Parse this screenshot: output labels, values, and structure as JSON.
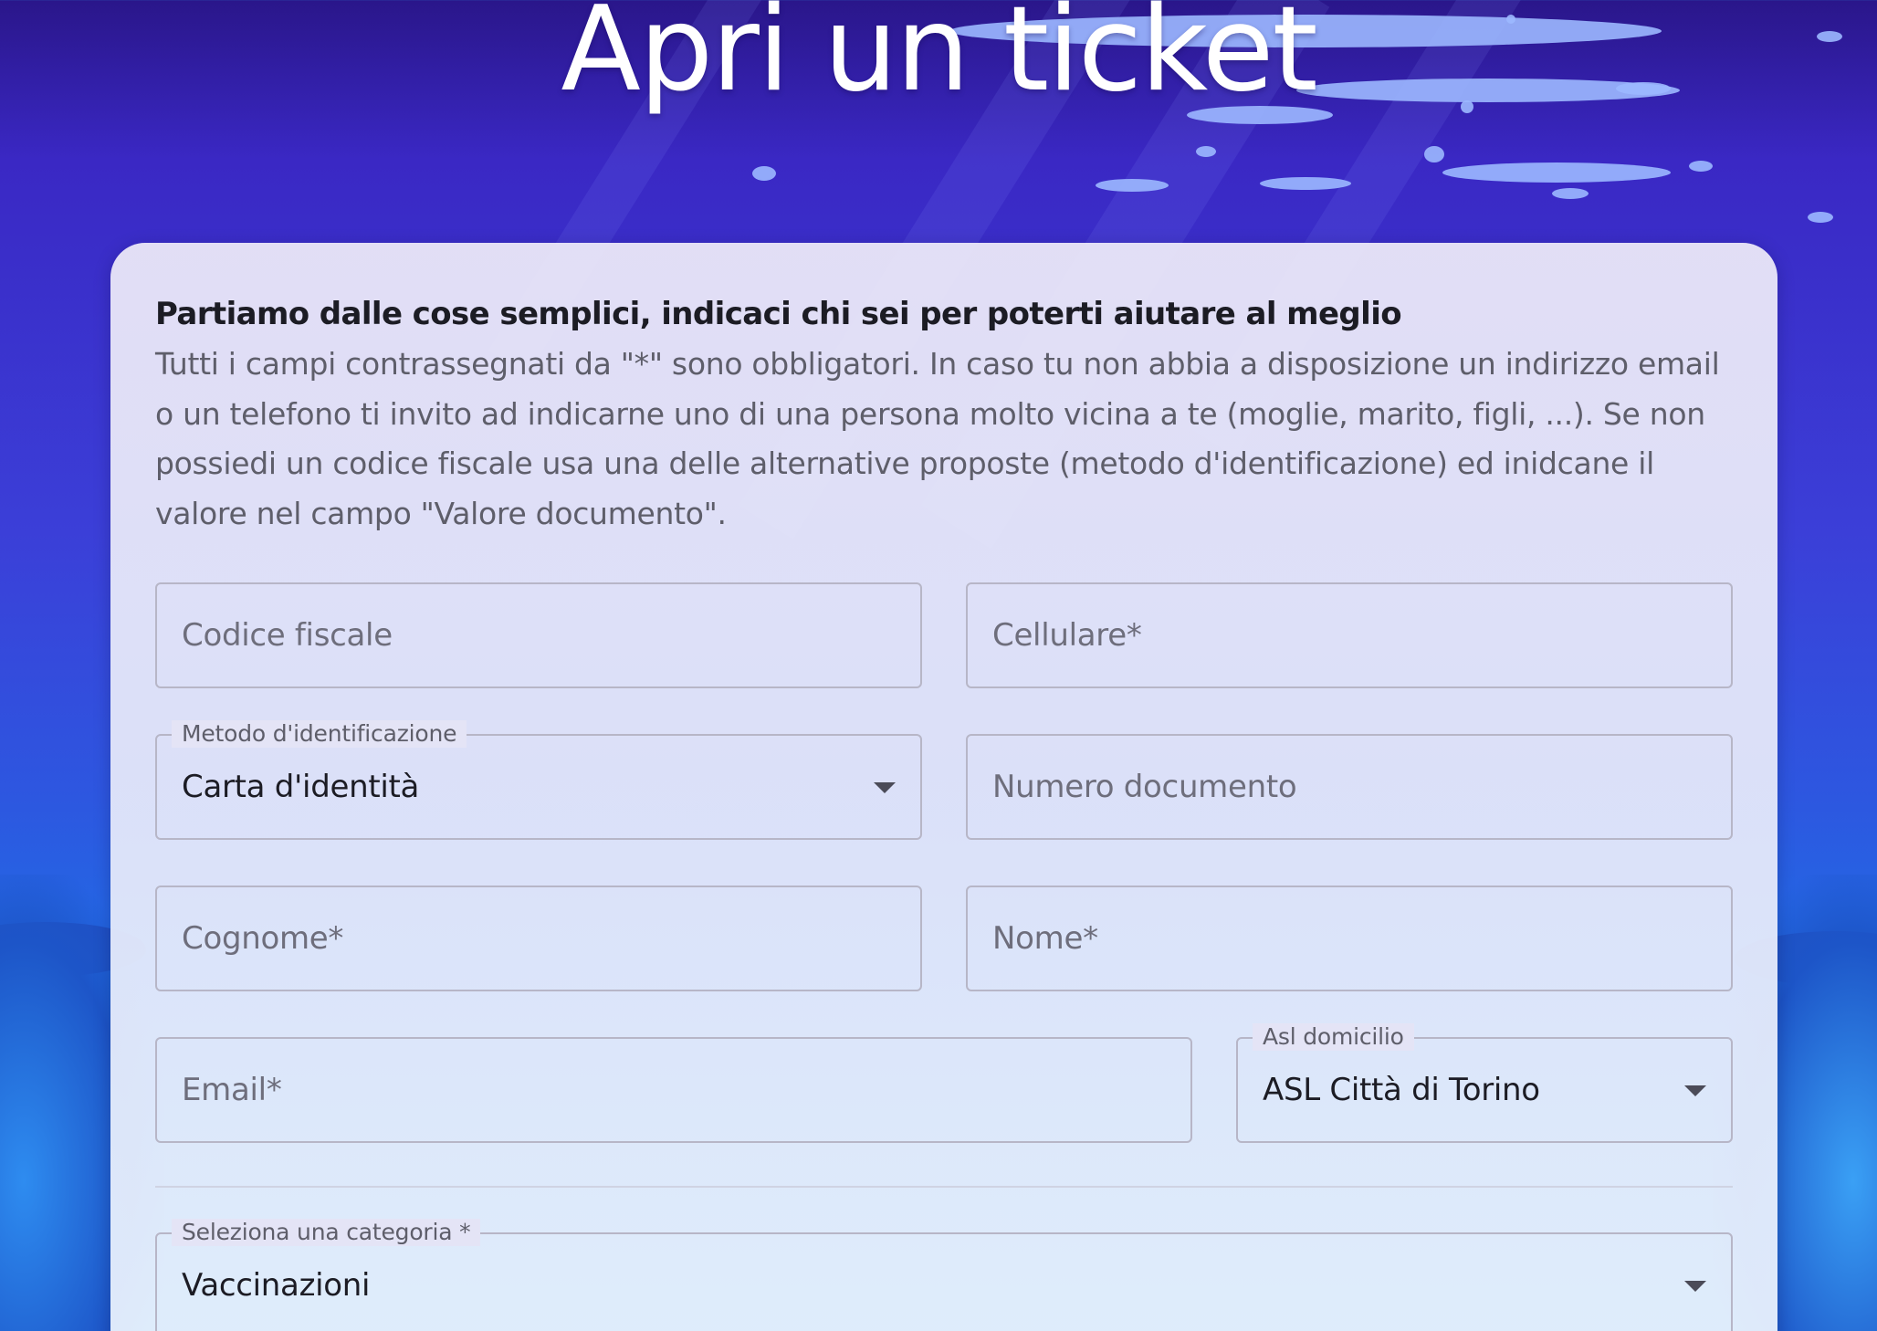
{
  "page": {
    "title": "Apri un ticket"
  },
  "intro": {
    "heading": "Partiamo dalle cose semplici, indicaci chi sei per poterti aiutare al meglio",
    "text": "Tutti i campi contrassegnati da \"*\" sono obbligatori. In caso tu non abbia a disposizione un indirizzo email o un telefono ti invito ad indicarne uno di una persona molto vicina a te (moglie, marito, figli, ...). Se non possiedi un codice fiscale usa una delle alternative proposte (metodo d'identificazione) ed inidcane il valore nel campo \"Valore documento\"."
  },
  "form": {
    "codice_fiscale": {
      "placeholder": "Codice fiscale",
      "value": ""
    },
    "cellulare": {
      "placeholder": "Cellulare*",
      "value": ""
    },
    "metodo_identificazione": {
      "label": "Metodo d'identificazione",
      "value": "Carta d'identità"
    },
    "numero_documento": {
      "placeholder": "Numero documento",
      "value": ""
    },
    "cognome": {
      "placeholder": "Cognome*",
      "value": ""
    },
    "nome": {
      "placeholder": "Nome*",
      "value": ""
    },
    "email": {
      "placeholder": "Email*",
      "value": ""
    },
    "asl_domicilio": {
      "label": "Asl domicilio",
      "value": "ASL Città di Torino"
    },
    "categoria": {
      "label": "Seleziona una categoria *",
      "value": "Vaccinazioni"
    }
  },
  "icons": {
    "dropdown": "caret-down-icon"
  },
  "colors": {
    "background_top": "#2a168a",
    "background_mid": "#3b3fd8",
    "background_bottom": "#2aa6f0",
    "card": "#e6e8f8",
    "title": "#ffffff",
    "text_primary": "#1c1c24",
    "text_secondary": "#5e5e6a",
    "field_border": "#b7b6c7"
  }
}
